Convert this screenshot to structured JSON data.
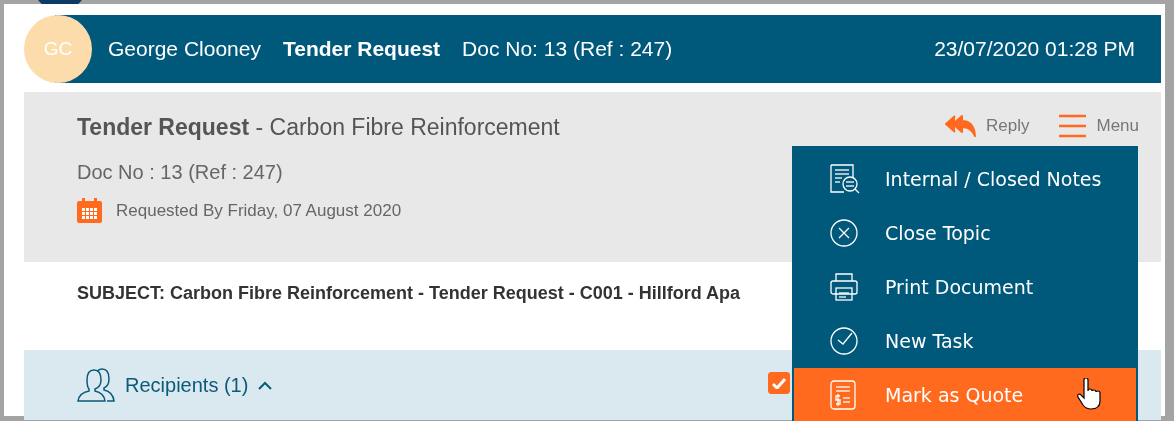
{
  "header": {
    "avatar_initials": "GC",
    "sender": "George Clooney",
    "doc_type": "Tender Request",
    "doc_ref": "Doc No: 13 (Ref : 247)",
    "timestamp": "23/07/2020 01:28 PM"
  },
  "summary": {
    "title": "**Tender Request** - Carbon Fibre Reinforcement",
    "doc_no": "Doc No : 13 (Ref : 247)",
    "requested_by": "Requested By Friday, 07 August 2020"
  },
  "actions": [
    {
      "label": "Reply",
      "kind": "reply"
    },
    {
      "label": "Menu",
      "kind": "menu"
    }
  ],
  "subject": "SUBJECT: Carbon Fibre Reinforcement - Tender Request - C001 - Hillford Apa",
  "recipients": {
    "label": "Recipients (1)",
    "expanded": true,
    "checked": true
  },
  "menu": {
    "items": [
      {
        "label": "Internal / Closed Notes",
        "kind": "notes",
        "selected": false
      },
      {
        "label": "Close Topic",
        "kind": "close",
        "selected": false
      },
      {
        "label": "Print Document",
        "kind": "print",
        "selected": false
      },
      {
        "label": "New Task",
        "kind": "task",
        "selected": false
      },
      {
        "label": "Mark as Quote",
        "kind": "quote",
        "selected": true
      }
    ]
  }
}
